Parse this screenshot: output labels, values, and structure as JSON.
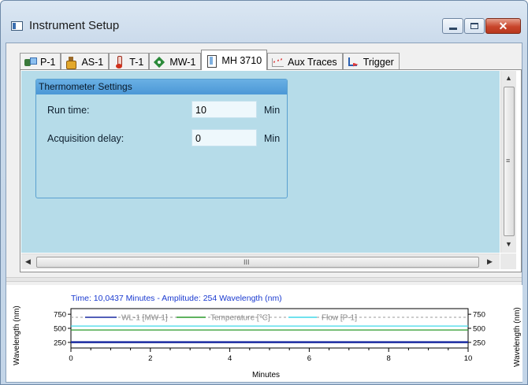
{
  "window": {
    "title": "Instrument Setup",
    "close_glyph": "✕"
  },
  "tabs": [
    {
      "label": "P-1",
      "icon": "pump-icon"
    },
    {
      "label": "AS-1",
      "icon": "autosampler-icon"
    },
    {
      "label": "T-1",
      "icon": "thermometer-icon"
    },
    {
      "label": "MW-1",
      "icon": "wavelength-icon"
    },
    {
      "label": "MH 3710",
      "icon": "module-icon",
      "active": true
    },
    {
      "label": "Aux Traces",
      "icon": "aux-traces-icon"
    },
    {
      "label": "Trigger",
      "icon": "trigger-icon"
    }
  ],
  "settings": {
    "group_title": "Thermometer Settings",
    "run_time_label": "Run time:",
    "run_time_value": "10",
    "run_time_unit": "Min",
    "acq_delay_label": "Acquisition delay:",
    "acq_delay_value": "0",
    "acq_delay_unit": "Min"
  },
  "scroll": {
    "up": "▲",
    "down": "▼",
    "left": "◀",
    "right": "▶",
    "v_grip": "≡",
    "h_grip": "III"
  },
  "colors": {
    "panel_bg": "#b6dce9",
    "group_header": "#4b97d6",
    "status_text": "#1a3ad0",
    "series_wl": "#1a2aa0",
    "series_temp": "#2a9a2a",
    "series_flow": "#40d8e8"
  },
  "chart_data": {
    "type": "line",
    "status": "Time:  10,0437 Minutes - Amplitude:  254 Wavelength (nm)",
    "xlabel": "Minutes",
    "ylabel_left": "Wavelength (nm)",
    "ylabel_right": "Wavelength (nm)",
    "xlim": [
      0,
      10
    ],
    "ylim": [
      150,
      850
    ],
    "x_ticks": [
      "0",
      "2",
      "4",
      "6",
      "8",
      "10"
    ],
    "y_ticks": [
      "750",
      "500",
      "250"
    ],
    "legend_position": "top",
    "series": [
      {
        "name": "WL-1 [MW-1]",
        "color": "#1a2aa0",
        "x": [
          0,
          10
        ],
        "y": [
          254,
          254
        ]
      },
      {
        "name": "Temperature [°C]",
        "color": "#2a9a2a",
        "x": [
          0,
          10
        ],
        "y": [
          470,
          470
        ]
      },
      {
        "name": "Flow [P-1]",
        "color": "#40d8e8",
        "x": [
          0,
          10
        ],
        "y": [
          540,
          540
        ]
      }
    ]
  }
}
